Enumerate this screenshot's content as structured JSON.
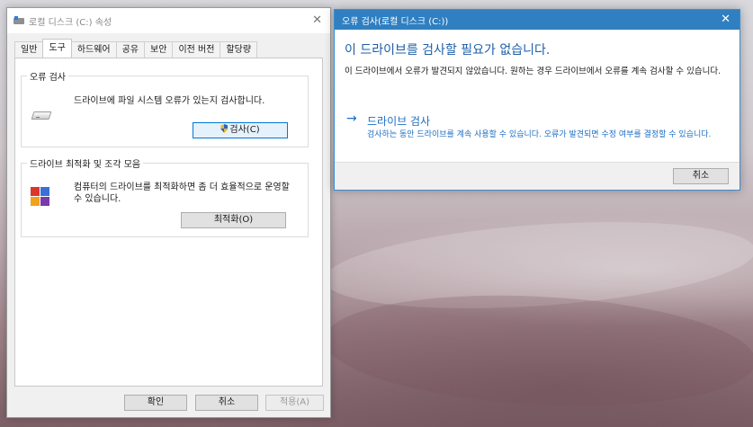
{
  "props": {
    "title": "로컬 디스크 (C:) 속성",
    "close_glyph": "✕",
    "tabs": [
      "일반",
      "도구",
      "하드웨어",
      "공유",
      "보안",
      "이전 버전",
      "할당량"
    ],
    "active_tab": "도구",
    "error_check": {
      "title": "오류 검사",
      "description": "드라이브에 파일 시스템 오류가 있는지 검사합니다.",
      "button": "검사(C)"
    },
    "optimize": {
      "title": "드라이브 최적화 및 조각 모음",
      "description": "컴퓨터의 드라이브를 최적화하면 좀 더 효율적으로 운영할 수 있습니다.",
      "button": "최적화(O)"
    },
    "footer": {
      "ok": "확인",
      "cancel": "취소",
      "apply": "적용(A)"
    }
  },
  "error_dialog": {
    "title": "오류 검사(로컬 디스크 (C:))",
    "close_glyph": "✕",
    "heading": "이 드라이브를 검사할 필요가 없습니다.",
    "message": "이 드라이브에서 오류가 발견되지 않았습니다. 원하는 경우 드라이브에서 오류를 계속 검사할 수 있습니다.",
    "link_arrow": "→",
    "link_title": "드라이브 검사",
    "link_description": "검사하는 동안 드라이브를 계속 사용할 수 있습니다. 오류가 발견되면 수정 여부를 결정할 수 있습니다.",
    "cancel": "취소"
  },
  "colors": {
    "accent": "#2f7fc1",
    "link": "#1c6ec4",
    "heading": "#1c5fa8"
  },
  "icons": [
    "drive-icon",
    "shield-icon",
    "defrag-icon",
    "close-icon",
    "arrow-right-icon"
  ]
}
